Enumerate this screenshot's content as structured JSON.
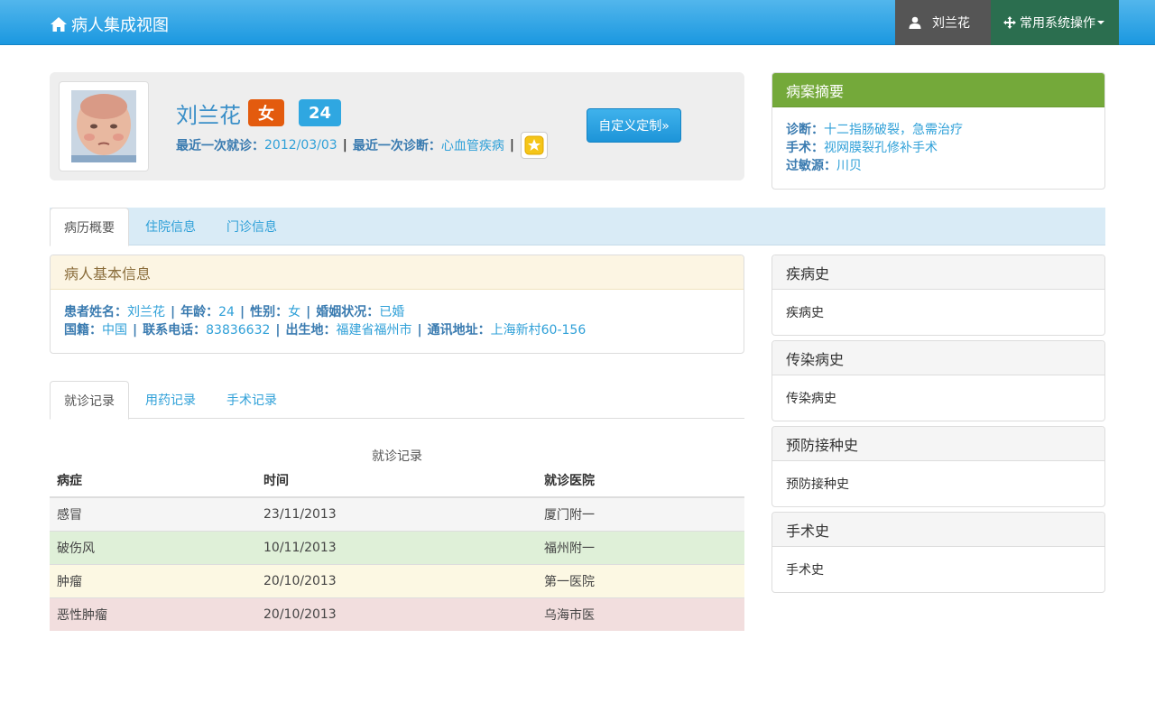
{
  "navbar": {
    "brand": "病人集成视图",
    "user": "刘兰花",
    "ops_menu": "常用系统操作"
  },
  "profile": {
    "name": "刘兰花",
    "sex": "女",
    "age": "24",
    "last_visit_label": "最近一次就诊：",
    "last_visit_value": "2012/03/03",
    "last_diag_label": "最近一次诊断：",
    "last_diag_value": "心血管疾病",
    "sep": "|",
    "custom_button": "自定义定制»"
  },
  "summary": {
    "title": "病案摘要",
    "rows": [
      {
        "label": "诊断：",
        "value": "十二指肠破裂，急需治疗"
      },
      {
        "label": "手术：",
        "value": "视网膜裂孔修补手术"
      },
      {
        "label": "过敏源：",
        "value": "川贝"
      }
    ]
  },
  "main_tabs": [
    "病历概要",
    "住院信息",
    "门诊信息"
  ],
  "basic_info": {
    "title": "病人基本信息",
    "line1": [
      {
        "label": "患者姓名：",
        "value": "刘兰花"
      },
      {
        "label": "年龄：",
        "value": "24"
      },
      {
        "label": "性别：",
        "value": "女"
      },
      {
        "label": "婚姻状况：",
        "value": "已婚"
      }
    ],
    "line2": [
      {
        "label": "国籍：",
        "value": "中国"
      },
      {
        "label": "联系电话：",
        "value": "83836632"
      },
      {
        "label": "出生地：",
        "value": "福建省福州市"
      },
      {
        "label": "通讯地址：",
        "value": "上海新村60-156"
      }
    ]
  },
  "sub_tabs": [
    "就诊记录",
    "用药记录",
    "手术记录"
  ],
  "visit_table": {
    "caption": "就诊记录",
    "headers": [
      "病症",
      "时间",
      "就诊医院"
    ],
    "rows": [
      [
        "感冒",
        "23/11/2013",
        "厦门附一"
      ],
      [
        "破伤风",
        "10/11/2013",
        "福州附一"
      ],
      [
        "肿瘤",
        "20/10/2013",
        "第一医院"
      ],
      [
        "恶性肿瘤",
        "20/10/2013",
        "乌海市医"
      ]
    ]
  },
  "history_panels": [
    {
      "title": "疾病史",
      "body": "疾病史"
    },
    {
      "title": "传染病史",
      "body": "传染病史"
    },
    {
      "title": "预防接种史",
      "body": "预防接种史"
    },
    {
      "title": "手术史",
      "body": "手术史"
    }
  ],
  "colors": {
    "navbar": "#1b98e0",
    "summary_header": "#74a93a",
    "sex_badge": "#e35b0e",
    "age_badge": "#2fa7e1",
    "link": "#2fa0d8"
  }
}
